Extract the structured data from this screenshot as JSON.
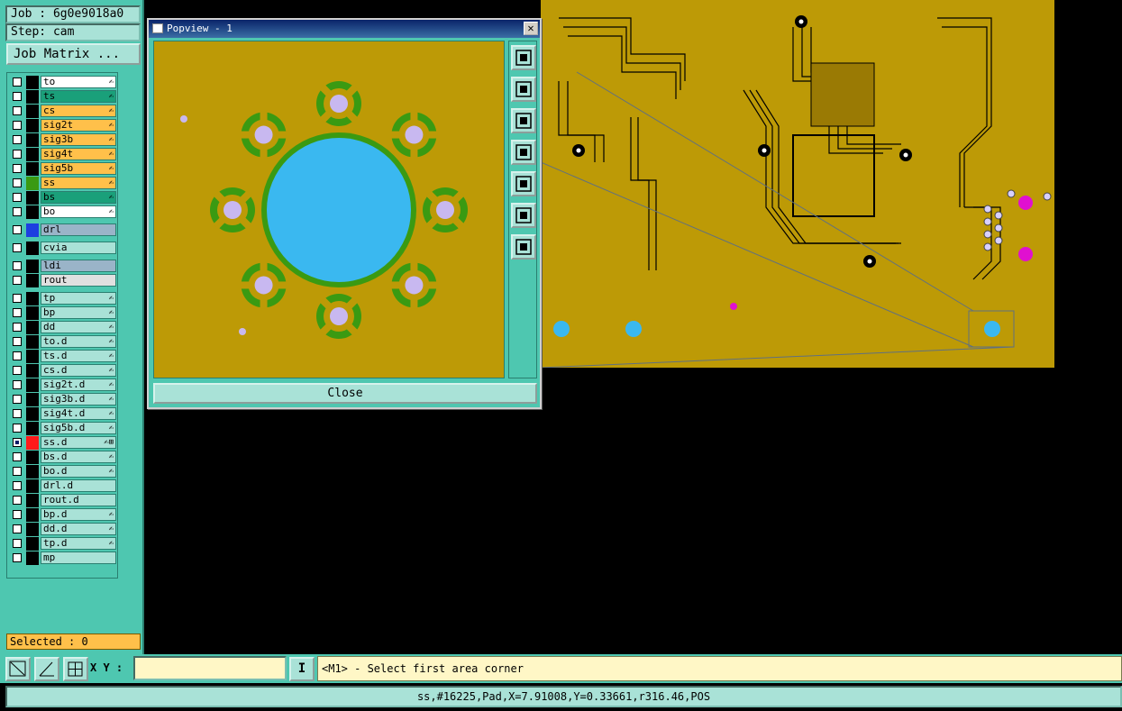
{
  "job": {
    "label": "Job : 6g0e9018a0",
    "step": "Step: cam",
    "matrix_button": "Job Matrix ..."
  },
  "layers": [
    {
      "name": "to",
      "bg": "#ffffff",
      "color": "#000000",
      "flag": "✍"
    },
    {
      "name": "ts",
      "bg": "#1aa07a",
      "color": "#000000",
      "flag": "✍"
    },
    {
      "name": "cs",
      "bg": "#ffc04a",
      "color": "#000000",
      "flag": "✍"
    },
    {
      "name": "sig2t",
      "bg": "#ffc04a",
      "color": "#000000",
      "flag": "✍"
    },
    {
      "name": "sig3b",
      "bg": "#ffc04a",
      "color": "#000000",
      "flag": "✍"
    },
    {
      "name": "sig4t",
      "bg": "#ffc04a",
      "color": "#000000",
      "flag": "✍"
    },
    {
      "name": "sig5b",
      "bg": "#ffc04a",
      "color": "#000000",
      "flag": "✍"
    },
    {
      "name": "ss",
      "bg": "#ffc04a",
      "color": "#3a9a12",
      "flag": "✍"
    },
    {
      "name": "bs",
      "bg": "#1aa07a",
      "color": "#000000",
      "flag": "✍"
    },
    {
      "name": "bo",
      "bg": "#ffffff",
      "color": "#000000",
      "flag": "✍"
    },
    {
      "name": "drl",
      "bg": "#9ab4c8",
      "color": "#1d3fe0",
      "flag": ""
    },
    {
      "name": "cvia",
      "bg": "#a9e2d7",
      "color": "#000000",
      "flag": ""
    },
    {
      "name": "ldi",
      "bg": "#9ab4c8",
      "color": "#000000",
      "flag": ""
    },
    {
      "name": "rout",
      "bg": "#e0e0e0",
      "color": "#000000",
      "flag": ""
    },
    {
      "name": "tp",
      "bg": "#a9e2d7",
      "color": "#000000",
      "flag": "✍"
    },
    {
      "name": "bp",
      "bg": "#a9e2d7",
      "color": "#000000",
      "flag": "✍"
    },
    {
      "name": "dd",
      "bg": "#a9e2d7",
      "color": "#000000",
      "flag": "✍"
    },
    {
      "name": "to.d",
      "bg": "#a9e2d7",
      "color": "#000000",
      "flag": "✍"
    },
    {
      "name": "ts.d",
      "bg": "#a9e2d7",
      "color": "#000000",
      "flag": "✍"
    },
    {
      "name": "cs.d",
      "bg": "#a9e2d7",
      "color": "#000000",
      "flag": "✍"
    },
    {
      "name": "sig2t.d",
      "bg": "#a9e2d7",
      "color": "#000000",
      "flag": "✍"
    },
    {
      "name": "sig3b.d",
      "bg": "#a9e2d7",
      "color": "#000000",
      "flag": "✍"
    },
    {
      "name": "sig4t.d",
      "bg": "#a9e2d7",
      "color": "#000000",
      "flag": "✍"
    },
    {
      "name": "sig5b.d",
      "bg": "#a9e2d7",
      "color": "#000000",
      "flag": "✍"
    },
    {
      "name": "ss.d",
      "bg": "#a9e2d7",
      "color": "#ff1a1a",
      "flag": "✍⊞",
      "selected": true
    },
    {
      "name": "bs.d",
      "bg": "#a9e2d7",
      "color": "#000000",
      "flag": "✍"
    },
    {
      "name": "bo.d",
      "bg": "#a9e2d7",
      "color": "#000000",
      "flag": "✍"
    },
    {
      "name": "drl.d",
      "bg": "#a9e2d7",
      "color": "#000000",
      "flag": ""
    },
    {
      "name": "rout.d",
      "bg": "#a9e2d7",
      "color": "#000000",
      "flag": ""
    },
    {
      "name": "bp.d",
      "bg": "#a9e2d7",
      "color": "#000000",
      "flag": "✍"
    },
    {
      "name": "dd.d",
      "bg": "#a9e2d7",
      "color": "#000000",
      "flag": "✍"
    },
    {
      "name": "tp.d",
      "bg": "#a9e2d7",
      "color": "#000000",
      "flag": "✍"
    },
    {
      "name": "mp",
      "bg": "#a9e2d7",
      "color": "#000000",
      "flag": ""
    }
  ],
  "selected_count": "Selected : 0",
  "popview": {
    "title": "Popview - 1",
    "close_x": "✕",
    "close_button": "Close",
    "toolbar_icons": [
      "zoom-fit-icon",
      "pan-up-icon",
      "pan-down-icon",
      "pan-left-icon",
      "pan-right-icon",
      "zoom-in-icon",
      "zoom-out-icon"
    ]
  },
  "command": {
    "xy_label": "X Y :",
    "xy_value": "",
    "info_label": "I",
    "prompt": "<M1> - Select first area corner"
  },
  "status": "ss,#16225,Pad,X=7.91008,Y=0.33661,r316.46,POS",
  "colors": {
    "board": "#bd9a06",
    "panel": "#4ec7b0",
    "pad_blue": "#3ab8f0",
    "ring_green": "#3a9a12",
    "hole": "#c8b8f0"
  }
}
